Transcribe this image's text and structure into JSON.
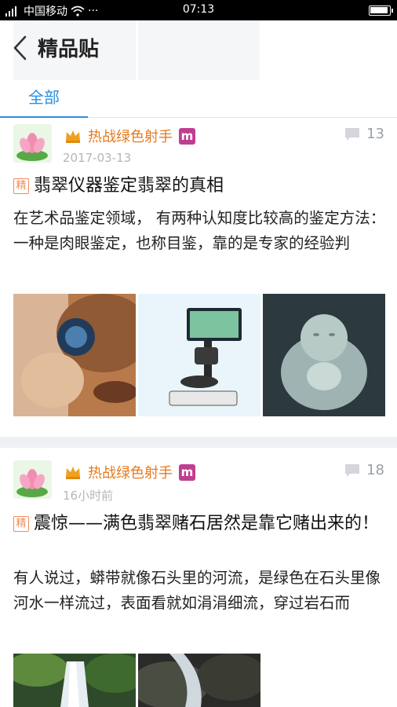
{
  "status_bar": {
    "carrier": "中国移动",
    "time": "07:13"
  },
  "header": {
    "title": "精品贴"
  },
  "tabs": [
    {
      "label": "全部",
      "active": true
    }
  ],
  "posts": [
    {
      "author": "热战绿色射手",
      "badge": "m",
      "date": "2017-03-13",
      "comments": "13",
      "tag": "精",
      "title": "翡翠仪器鉴定翡翠的真相",
      "excerpt": "在艺术品鉴定领域， 有两种认知度比较高的鉴定方法：一种是肉眼鉴定，也称目鉴，靠的是专家的经验判",
      "images": [
        "loupe-inspection",
        "gem-microscope",
        "jade-buddha"
      ]
    },
    {
      "author": "热战绿色射手",
      "badge": "m",
      "date": "16小时前",
      "comments": "18",
      "tag": "精",
      "title": "震惊——满色翡翠赌石居然是靠它赌出来的！",
      "excerpt": "有人说过，蟒带就像石头里的河流，是绿色在石头里像河水一样流过，表面看就如涓涓细流，穿过岩石而",
      "images": [
        "waterfall",
        "stream-rocks"
      ]
    }
  ],
  "colors": {
    "accent": "#2a8fe0",
    "author": "#e57a1d",
    "badge": "#c03e8f",
    "jing": "#f28a57",
    "date": "#b6b6b6"
  }
}
